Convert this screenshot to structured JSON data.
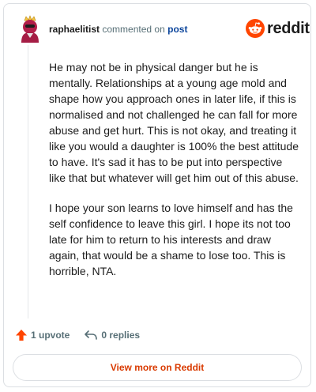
{
  "comment": {
    "username": "raphaelitist",
    "action": "commented on",
    "link_text": "post",
    "paragraphs": [
      "He may not be in physical danger but he is mentally. Relationships at a young age mold and shape how you approach ones in later life, if this is normalised and not challenged he can fall for more abuse and get hurt. This is not okay, and treating it like you would a daughter is 100% the best attitude to have. It's sad it has to be put into perspective like that but whatever will get him out of this abuse.",
      "I hope your son learns to love himself and has the self confidence to leave this girl. I hope its not too late for him to return to his interests and draw again, that would be a shame to lose too. This is horrible, NTA."
    ]
  },
  "brand": {
    "logo_text": "reddit",
    "icon": "reddit-snoo-icon",
    "color": "#ff4500"
  },
  "footer": {
    "upvote_label": "1 upvote",
    "reply_label": "0 replies",
    "upvote_icon": "upvote-arrow-icon",
    "reply_icon": "reply-arrow-icon",
    "upvote_color": "#ff4500"
  },
  "view_more": {
    "label": "View more on Reddit",
    "color": "#d93a00"
  }
}
